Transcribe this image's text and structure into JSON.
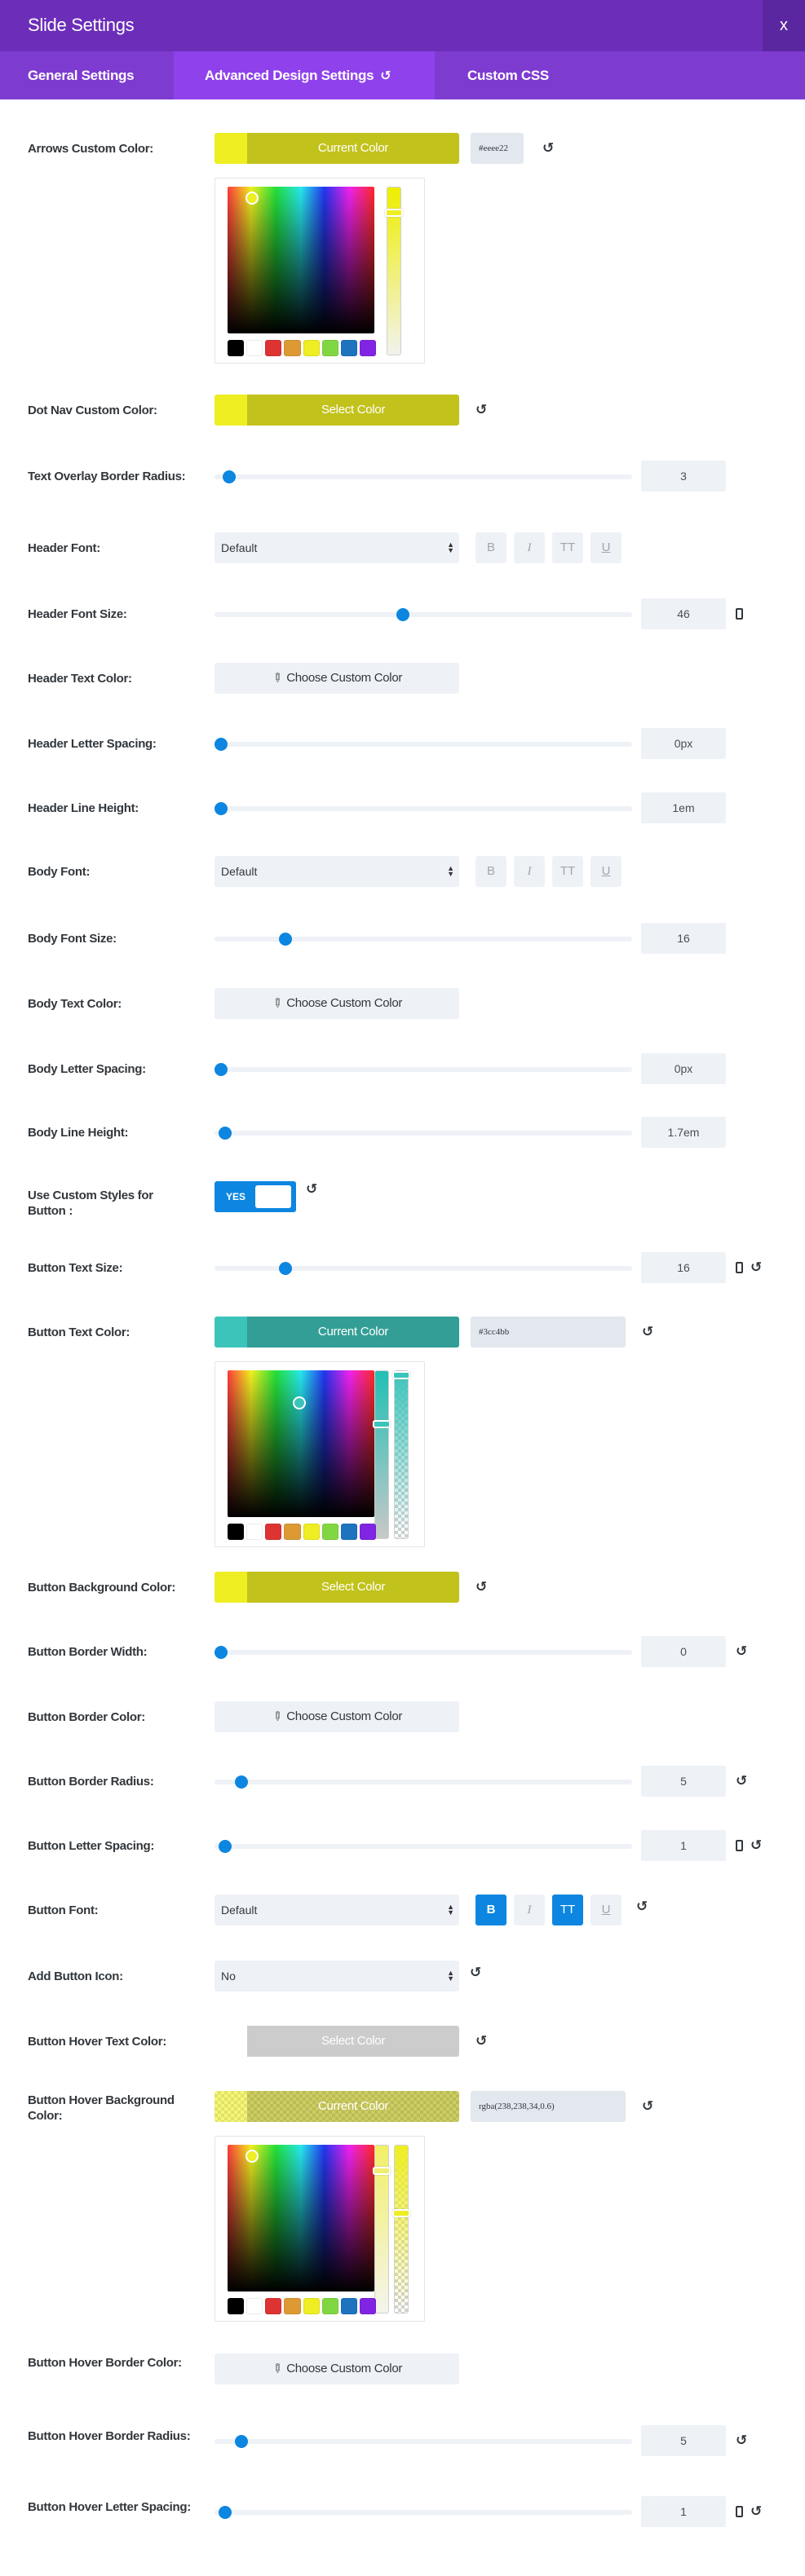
{
  "header": {
    "title": "Slide Settings",
    "close_label": "x"
  },
  "tabs": [
    {
      "label": "General Settings",
      "active": false
    },
    {
      "label": "Advanced Design Settings",
      "active": true
    },
    {
      "label": "Custom CSS",
      "active": false
    }
  ],
  "icons": {
    "reset": "↺",
    "dropper": "⚲"
  },
  "colors": {
    "header_bg": "#6c2eb9",
    "tab_bar_bg": "#7e3bd0",
    "active_tab_bg": "#8f42ec",
    "accent_blue": "#0c86e0",
    "yellow": "#eeee22",
    "yellow_dark": "#c2c21c",
    "teal": "#3cc4bb",
    "teal_dark": "#339e95",
    "gray_swatch": "#cccccc"
  },
  "swatch_palette": [
    "#000000",
    "#ffffff",
    "#dd3333",
    "#dd9933",
    "#eeee22",
    "#81d742",
    "#1e73be",
    "#8224e3"
  ],
  "fields": {
    "arrows_color": {
      "label": "Arrows Custom Color:",
      "button": "Current Color",
      "hex": "#eeee22"
    },
    "dot_nav_color": {
      "label": "Dot Nav Custom Color:",
      "button": "Select Color"
    },
    "overlay_radius": {
      "label": "Text Overlay Border Radius:",
      "value": "3",
      "slider_percent": 2
    },
    "header_font": {
      "label": "Header Font:",
      "select": "Default",
      "b": "B",
      "i": "I",
      "tt": "TT",
      "u": "U"
    },
    "header_font_size": {
      "label": "Header Font Size:",
      "value": "46",
      "slider_percent": 45
    },
    "header_text_color": {
      "label": "Header Text Color:",
      "button": "Choose Custom Color"
    },
    "header_letter_spacing": {
      "label": "Header Letter Spacing:",
      "value": "0px",
      "slider_percent": 0
    },
    "header_line_height": {
      "label": "Header Line Height:",
      "value": "1em",
      "slider_percent": 0
    },
    "body_font": {
      "label": "Body Font:",
      "select": "Default",
      "b": "B",
      "i": "I",
      "tt": "TT",
      "u": "U"
    },
    "body_font_size": {
      "label": "Body Font Size:",
      "value": "16",
      "slider_percent": 16
    },
    "body_text_color": {
      "label": "Body Text Color:",
      "button": "Choose Custom Color"
    },
    "body_letter_spacing": {
      "label": "Body Letter Spacing:",
      "value": "0px",
      "slider_percent": 0
    },
    "body_line_height": {
      "label": "Body Line Height:",
      "value": "1.7em",
      "slider_percent": 1
    },
    "custom_button": {
      "label": "Use Custom Styles for Button :",
      "toggle": "YES"
    },
    "button_text_size": {
      "label": "Button Text Size:",
      "value": "16",
      "slider_percent": 16
    },
    "button_text_color": {
      "label": "Button Text Color:",
      "button": "Current Color",
      "hex": "#3cc4bb"
    },
    "button_bg_color": {
      "label": "Button Background Color:",
      "button": "Select Color"
    },
    "button_border_width": {
      "label": "Button Border Width:",
      "value": "0",
      "slider_percent": 0
    },
    "button_border_color": {
      "label": "Button Border Color:",
      "button": "Choose Custom Color"
    },
    "button_border_radius": {
      "label": "Button Border Radius:",
      "value": "5",
      "slider_percent": 5
    },
    "button_letter_spacing": {
      "label": "Button Letter Spacing:",
      "value": "1",
      "slider_percent": 1
    },
    "button_font": {
      "label": "Button Font:",
      "select": "Default",
      "b": "B",
      "i": "I",
      "tt": "TT",
      "u": "U"
    },
    "button_icon": {
      "label": "Add Button Icon:",
      "select": "No"
    },
    "button_hover_text_color": {
      "label": "Button Hover Text Color:",
      "button": "Select Color"
    },
    "button_hover_bg_color": {
      "label": "Button Hover Background Color:",
      "button": "Current Color",
      "hex": "rgba(238,238,34,0.6)"
    },
    "button_hover_border_color": {
      "label": "Button Hover Border Color:",
      "button": "Choose Custom Color"
    },
    "button_hover_border_radius": {
      "label": "Button Hover Border Radius:",
      "value": "5",
      "slider_percent": 5
    },
    "button_hover_letter_spacing": {
      "label": "Button Hover Letter Spacing:",
      "value": "1",
      "slider_percent": 1
    }
  }
}
